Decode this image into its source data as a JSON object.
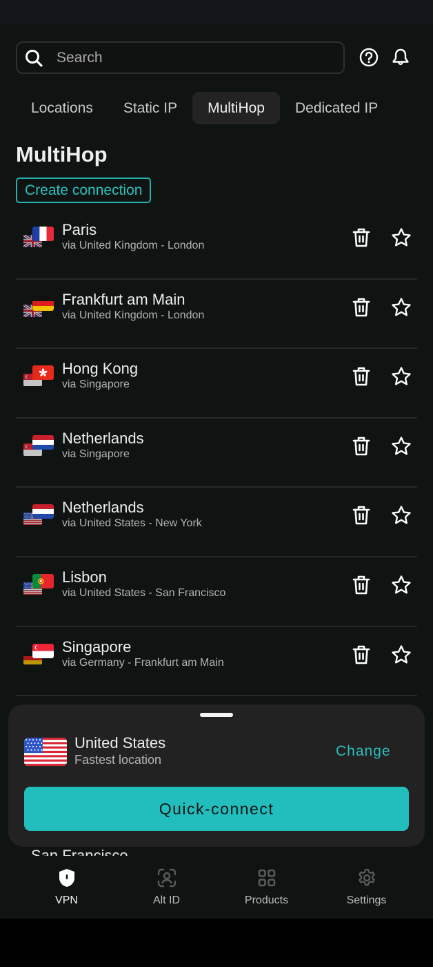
{
  "header": {
    "search_placeholder": "Search",
    "search_value": "",
    "help_icon": "question-circle-icon",
    "notifications_icon": "bell-icon"
  },
  "tabs": [
    {
      "label": "Locations",
      "active": false
    },
    {
      "label": "Static IP",
      "active": false
    },
    {
      "label": "MultiHop",
      "active": true
    },
    {
      "label": "Dedicated IP",
      "active": false
    }
  ],
  "section": {
    "title": "MultiHop",
    "create_button": "Create connection"
  },
  "connections": [
    {
      "name": "Paris",
      "via": "via United Kingdom - London",
      "exit_flag": "fr",
      "entry_flag": "gb"
    },
    {
      "name": "Frankfurt am Main",
      "via": "via United Kingdom - London",
      "exit_flag": "de",
      "entry_flag": "gb"
    },
    {
      "name": "Hong Kong",
      "via": "via Singapore",
      "exit_flag": "hk",
      "entry_flag": "sg"
    },
    {
      "name": "Netherlands",
      "via": "via Singapore",
      "exit_flag": "nl",
      "entry_flag": "sg"
    },
    {
      "name": "Netherlands",
      "via": "via United States - New York",
      "exit_flag": "nl",
      "entry_flag": "us"
    },
    {
      "name": "Lisbon",
      "via": "via United States - San Francisco",
      "exit_flag": "pt",
      "entry_flag": "us"
    },
    {
      "name": "Singapore",
      "via": "via Germany - Frankfurt am Main",
      "exit_flag": "sg",
      "entry_flag": "de"
    }
  ],
  "peek_row": {
    "name": "San Francisco",
    "exit_flag": "us"
  },
  "row_actions": {
    "delete_icon": "trash-icon",
    "favorite_icon": "star-icon"
  },
  "quick_connect": {
    "country": "United States",
    "subtitle": "Fastest location",
    "flag": "us",
    "change_label": "Change",
    "connect_label": "Quick-connect"
  },
  "bottom_nav": [
    {
      "label": "VPN",
      "icon": "shield-icon",
      "active": true
    },
    {
      "label": "Alt ID",
      "icon": "face-id-icon",
      "active": false
    },
    {
      "label": "Products",
      "icon": "grid-icon",
      "active": false
    },
    {
      "label": "Settings",
      "icon": "gear-icon",
      "active": false
    }
  ],
  "colors": {
    "accent": "#22bebe",
    "background": "#0f1311",
    "sheet": "#222222"
  }
}
